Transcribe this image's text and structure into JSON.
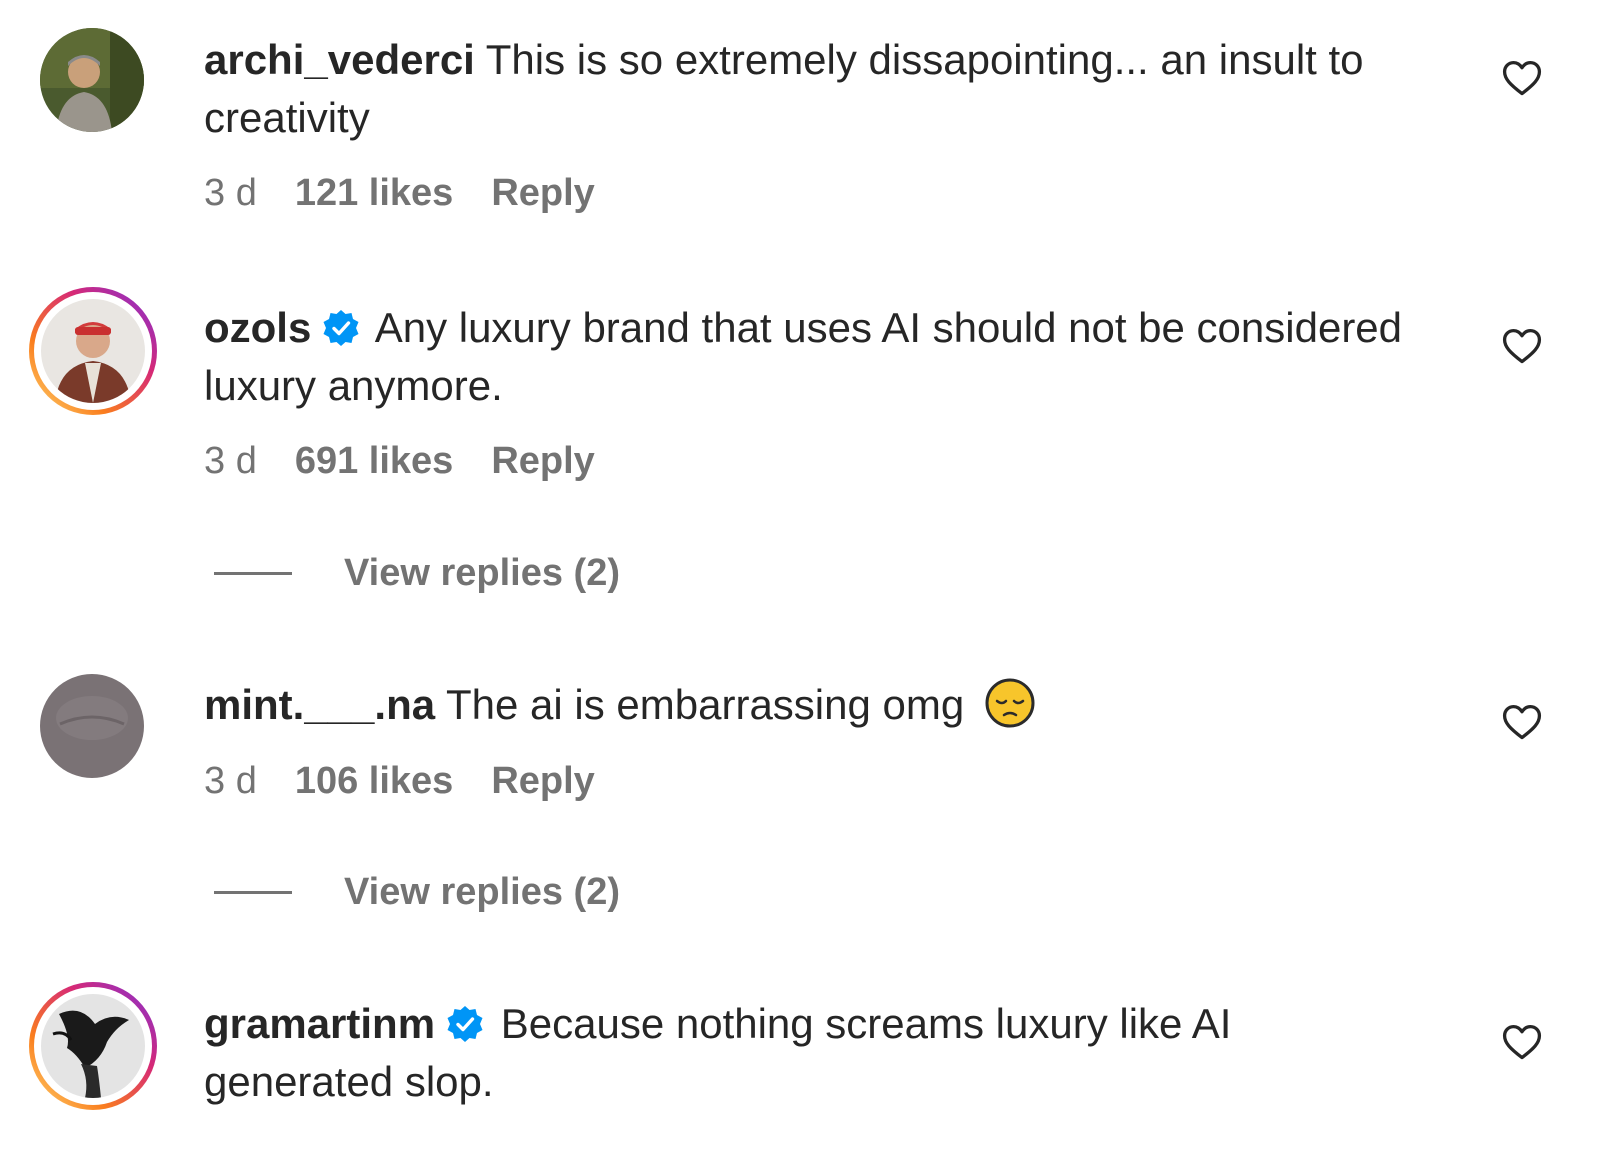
{
  "comments": [
    {
      "username": "archi_vederci",
      "verified": false,
      "text": "This is so extremely dissapointing... an insult to creativity",
      "time": "3 d",
      "likes": "121 likes",
      "reply": "Reply"
    },
    {
      "username": "ozols",
      "verified": true,
      "text": "Any luxury brand that uses AI should not be considered luxury anymore.",
      "time": "3 d",
      "likes": "691 likes",
      "reply": "Reply",
      "view_replies": "View replies (2)"
    },
    {
      "username": "mint.___.na",
      "verified": false,
      "text": "The ai is embarrassing omg",
      "emoji": "pensive-face-emoji",
      "time": "3 d",
      "likes": "106 likes",
      "reply": "Reply",
      "view_replies": "View replies (2)"
    },
    {
      "username": "gramartinm",
      "verified": true,
      "text": "Because nothing screams luxury like AI generated slop."
    }
  ],
  "colors": {
    "text": "#262626",
    "secondary": "#737373",
    "verified_blue": "#0095f6"
  }
}
